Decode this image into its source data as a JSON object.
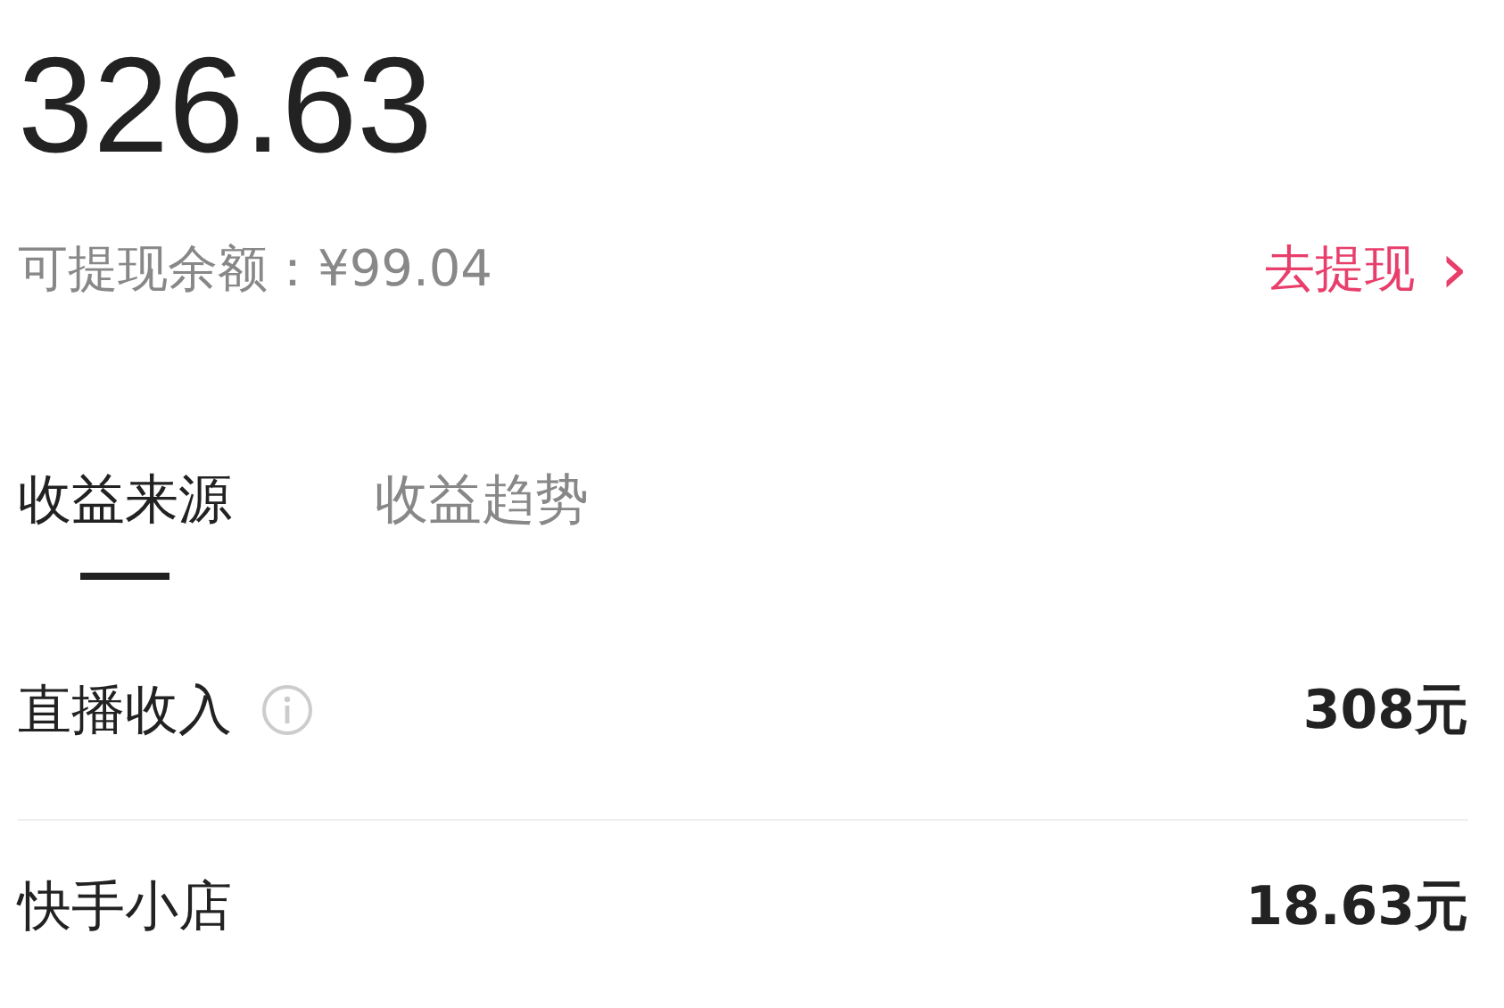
{
  "total": "326.63",
  "balance": "可提现余额：¥99.04",
  "withdraw": {
    "label": "去提现",
    "arrow": "›"
  },
  "tabs": [
    {
      "label": "收益来源",
      "selected": true
    },
    {
      "label": "收益趋势",
      "selected": false
    }
  ],
  "rows": [
    {
      "label": "直播收入",
      "info": true,
      "value": "308元"
    },
    {
      "label": "快手小店",
      "info": false,
      "value": "18.63元"
    }
  ]
}
